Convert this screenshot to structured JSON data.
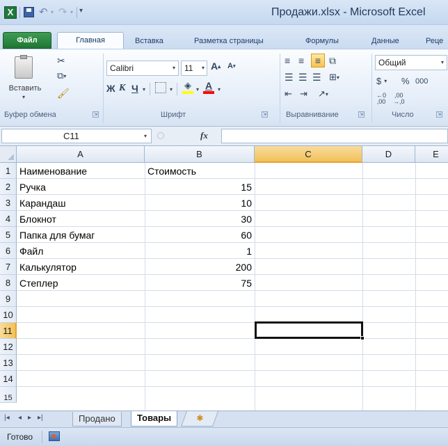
{
  "window": {
    "title": "Продажи.xlsx - Microsoft Excel",
    "app_icon": "excel-icon",
    "qat": [
      "save-icon",
      "undo-icon",
      "redo-icon",
      "customize-qat-icon"
    ]
  },
  "ribbon_tabs": {
    "file": "Файл",
    "home": "Главная",
    "insert": "Вставка",
    "page_layout": "Разметка страницы",
    "formulas": "Формулы",
    "data": "Данные",
    "review": "Реце"
  },
  "ribbon": {
    "clipboard": {
      "paste_label": "Вставить",
      "group_label": "Буфер обмена"
    },
    "font": {
      "name": "Calibri",
      "size": "11",
      "bold": "Ж",
      "italic": "К",
      "underline": "Ч",
      "group_label": "Шрифт",
      "font_color": "#ff0000",
      "highlight_color": "#ffff00"
    },
    "alignment": {
      "group_label": "Выравнивание"
    },
    "number": {
      "format": "Общий",
      "currency": "$",
      "percent": "%",
      "thousands": "000",
      "group_label": "Число"
    }
  },
  "formula_bar": {
    "name_box": "C11",
    "fx": "fx",
    "formula": ""
  },
  "columns": [
    "A",
    "B",
    "C",
    "D",
    "E"
  ],
  "rows": [
    "1",
    "2",
    "3",
    "4",
    "5",
    "6",
    "7",
    "8",
    "9",
    "10",
    "11",
    "12",
    "13",
    "14",
    "15"
  ],
  "cells": {
    "header": {
      "name": "Наименование",
      "cost": "Стоимость"
    },
    "items": [
      {
        "name": "Ручка",
        "cost": "15"
      },
      {
        "name": "Карандаш",
        "cost": "10"
      },
      {
        "name": "Блокнот",
        "cost": "30"
      },
      {
        "name": "Папка для бумаг",
        "cost": "60"
      },
      {
        "name": "Файл",
        "cost": "1"
      },
      {
        "name": "Калькулятор",
        "cost": "200"
      },
      {
        "name": "Степлер",
        "cost": "75"
      }
    ]
  },
  "active_cell": {
    "ref": "C11",
    "row": "11",
    "column": "C",
    "highlight_color": "#f5c451"
  },
  "sheet_tabs": {
    "tabs": [
      "Продано",
      "Товары"
    ],
    "active": "Товары",
    "nav_icons": [
      "first-sheet-icon",
      "prev-sheet-icon",
      "next-sheet-icon",
      "last-sheet-icon"
    ],
    "insert_icon": "insert-sheet-icon"
  },
  "status": {
    "text": "Готово",
    "macro_icon": "record-macro-icon"
  }
}
